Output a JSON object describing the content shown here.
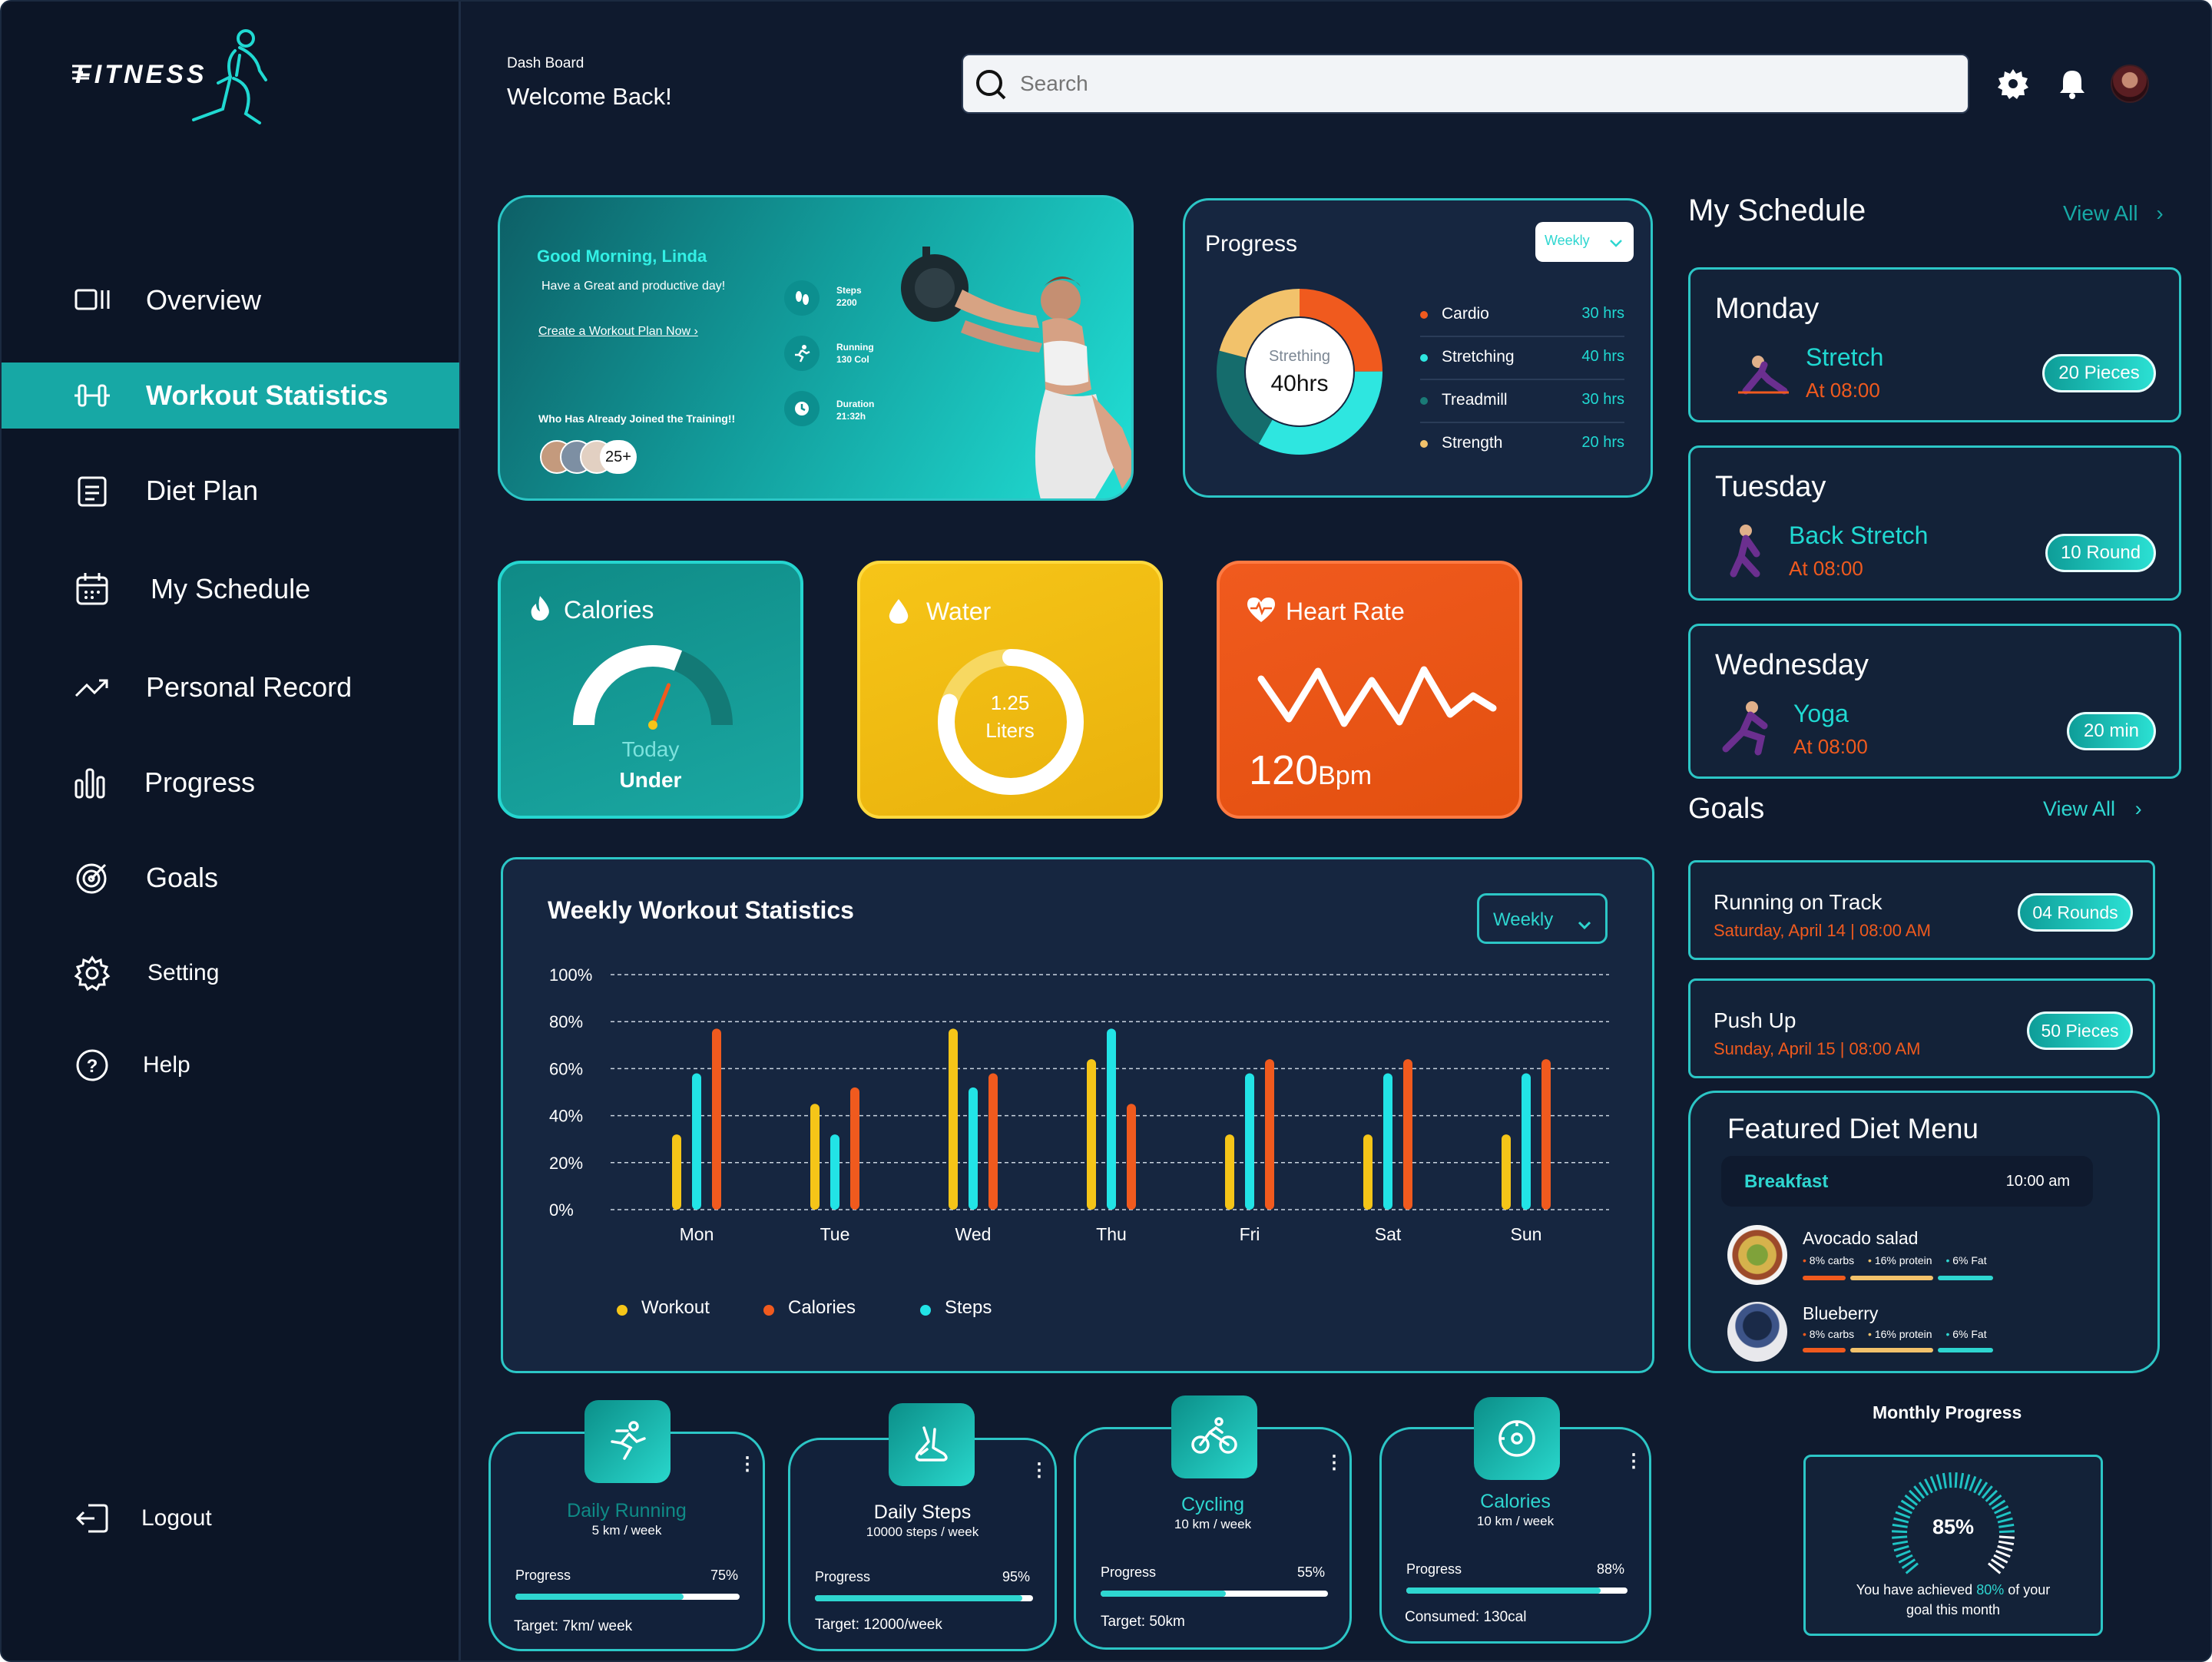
{
  "brand": {
    "logo_text": "FITNESS"
  },
  "sidebar": {
    "items": [
      {
        "label": "Overview"
      },
      {
        "label": "Workout Statistics"
      },
      {
        "label": "Diet Plan"
      },
      {
        "label": "My Schedule"
      },
      {
        "label": "Personal Record"
      },
      {
        "label": "Progress"
      },
      {
        "label": "Goals"
      },
      {
        "label": "Setting"
      },
      {
        "label": "Help"
      }
    ],
    "logout": "Logout"
  },
  "header": {
    "breadcrumb": "Dash Board",
    "title": "Welcome Back!",
    "search_placeholder": "Search"
  },
  "hero": {
    "greeting": "Good Morning, Linda",
    "subtitle": "Have a Great and productive day!",
    "cta": "Create a Workout Plan Now ›",
    "joined_label": "Who Has Already Joined the Training!!",
    "joined_count": "25+",
    "stats": [
      {
        "label": "Steps",
        "value": "2200"
      },
      {
        "label": "Running",
        "value": "130 Col"
      },
      {
        "label": "Duration",
        "value": "21:32h"
      }
    ]
  },
  "progress_card": {
    "title": "Progress",
    "period": "Weekly",
    "center_label": "Strething",
    "center_value": "40hrs",
    "items": [
      {
        "name": "Cardio",
        "value": "30 hrs",
        "color": "#f05a1e"
      },
      {
        "name": "Stretching",
        "value": "40 hrs",
        "color": "#2ee6e0"
      },
      {
        "name": "Treadmill",
        "value": "30 hrs",
        "color": "#1a7a76"
      },
      {
        "name": "Strength",
        "value": "20 hrs",
        "color": "#f2c26b"
      }
    ]
  },
  "calories": {
    "title": "Calories",
    "line1": "Today",
    "line2": "Under",
    "fraction": 0.62
  },
  "water": {
    "title": "Water",
    "value": "1.25",
    "unit": "Liters",
    "fraction": 0.8
  },
  "heart": {
    "title": "Heart Rate",
    "value": "120",
    "unit": "Bpm"
  },
  "weekly": {
    "title": "Weekly Workout Statistics",
    "period": "Weekly",
    "legend": [
      {
        "name": "Workout",
        "color": "#f5c518"
      },
      {
        "name": "Calories",
        "color": "#f05a1e"
      },
      {
        "name": "Steps",
        "color": "#22e3e6"
      }
    ]
  },
  "chart_data": {
    "type": "bar",
    "title": "Weekly Workout Statistics",
    "categories": [
      "Mon",
      "Tue",
      "Wed",
      "Thu",
      "Fri",
      "Sat",
      "Sun"
    ],
    "y_ticks": [
      "100%",
      "80%",
      "60%",
      "40%",
      "20%",
      "0%"
    ],
    "ylim": [
      0,
      100
    ],
    "series": [
      {
        "name": "Workout",
        "color": "#f5c518",
        "values": [
          32,
          45,
          77,
          64,
          32,
          32,
          32
        ]
      },
      {
        "name": "Steps",
        "color": "#22e3e6",
        "values": [
          58,
          32,
          52,
          77,
          58,
          58,
          58
        ]
      },
      {
        "name": "Calories",
        "color": "#f05a1e",
        "values": [
          77,
          52,
          58,
          45,
          64,
          64,
          64
        ]
      }
    ]
  },
  "bottom_cards": [
    {
      "title": "Daily Running",
      "sub": "5 km / week",
      "progress_label": "Progress",
      "pct": "75%",
      "fraction": 0.75,
      "footer": "Target: 7km/ week"
    },
    {
      "title": "Daily Steps",
      "sub": "10000 steps / week",
      "progress_label": "Progress",
      "pct": "95%",
      "fraction": 0.95,
      "footer": "Target: 12000/week"
    },
    {
      "title": "Cycling",
      "sub": "10 km / week",
      "progress_label": "Progress",
      "pct": "55%",
      "fraction": 0.55,
      "footer": "Target: 50km"
    },
    {
      "title": "Calories",
      "sub": "10 km / week",
      "progress_label": "Progress",
      "pct": "88%",
      "fraction": 0.88,
      "footer": "Consumed: 130cal"
    }
  ],
  "schedule": {
    "title": "My Schedule",
    "view_all": "View All",
    "items": [
      {
        "day": "Monday",
        "activity": "Stretch",
        "time": "At 08:00",
        "badge": "20 Pieces"
      },
      {
        "day": "Tuesday",
        "activity": "Back Stretch",
        "time": "At 08:00",
        "badge": "10 Round"
      },
      {
        "day": "Wednesday",
        "activity": "Yoga",
        "time": "At 08:00",
        "badge": "20 min"
      }
    ]
  },
  "goals": {
    "title": "Goals",
    "view_all": "View All",
    "items": [
      {
        "name": "Running on Track",
        "date": "Saturday, April 14 | 08:00 AM",
        "badge": "04 Rounds"
      },
      {
        "name": "Push Up",
        "date": "Sunday, April 15 | 08:00 AM",
        "badge": "50 Pieces"
      }
    ]
  },
  "diet": {
    "title": "Featured Diet Menu",
    "meal": "Breakfast",
    "time": "10:00 am",
    "items": [
      {
        "name": "Avocado salad",
        "carbs": "8% carbs",
        "protein": "16% protein",
        "fat": "6% Fat"
      },
      {
        "name": "Blueberry",
        "carbs": "8% carbs",
        "protein": "16% protein",
        "fat": "6% Fat"
      }
    ]
  },
  "monthly": {
    "title": "Monthly Progress",
    "value": "85%",
    "fraction": 0.85,
    "text_pre": "You have achieved ",
    "text_pct": "80%",
    "text_post": " of your",
    "text_line2": "goal this month"
  }
}
